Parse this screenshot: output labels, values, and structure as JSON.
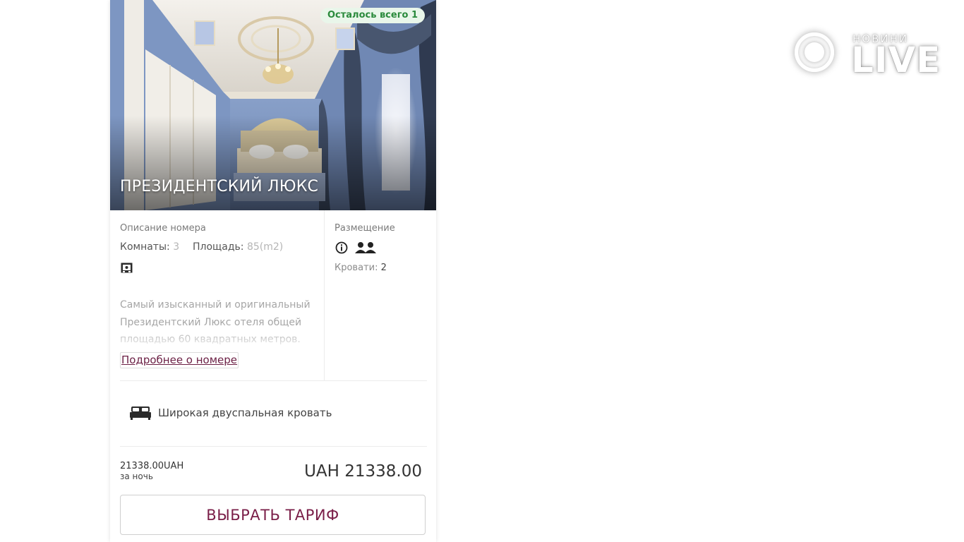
{
  "room": {
    "badge": "Осталось всего 1",
    "title": "ПРЕЗИДЕНТСКИЙ ЛЮКС",
    "description_heading": "Описание номера",
    "rooms_label": "Комнаты:",
    "rooms_value": "3",
    "area_label": "Площадь:",
    "area_value": "85(m2)",
    "description": "Самый изысканный и оригинальный Президентский Люкс отеля общей площадью 60 квадратных метров.",
    "more_link": "Подробнее о номере",
    "placement_heading": "Размещение",
    "beds_label": "Кровати:",
    "beds_value": "2",
    "bed_type": "Широкая двуспальная кровать"
  },
  "pricing": {
    "price_small": "21338.00UAH",
    "per_night": "за ночь",
    "price_total": "UAH 21338.00",
    "select_button": "ВЫБРАТЬ ТАРИФ"
  },
  "logo": {
    "small_text": "НОВИНИ",
    "big_text": "LIVE"
  },
  "icons": {
    "amenity": "safe-icon",
    "info": "info-icon",
    "guests": "two-persons-icon",
    "bed": "double-bed-icon"
  },
  "colors": {
    "accent": "#7a1e48",
    "badge_text": "#2a8a3c",
    "badge_bg": "#e9f6ea"
  }
}
